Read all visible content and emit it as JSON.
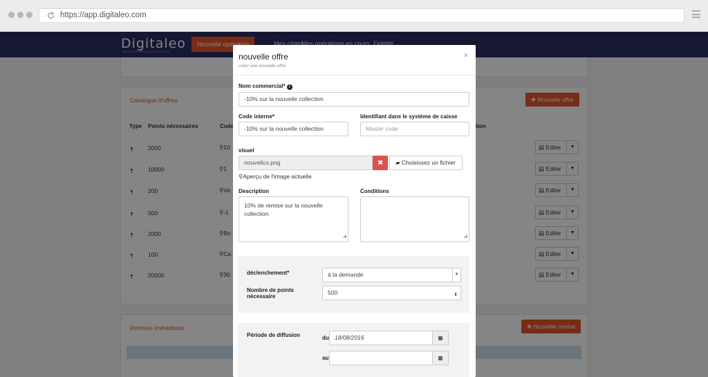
{
  "browser": {
    "url": "https://app.digitaleo.com"
  },
  "nav": {
    "logo": "Digitaleo",
    "logo_sub": "RELATIONNEL & MARKETING",
    "primary_button": "Nouvelle opération",
    "links": [
      "Mes cibles",
      "Mes opérations en cours",
      "Fidélité"
    ]
  },
  "catalogue": {
    "title": "Catalogue d'offres",
    "add_button": "Nouvelle offre",
    "columns": {
      "type": "Type",
      "points": "Points nécessaires",
      "code": "Code",
      "tail": "tion"
    },
    "rows": [
      {
        "points": "2000",
        "code": "10"
      },
      {
        "points": "10000",
        "code": "1"
      },
      {
        "points": "200",
        "code": "Ve"
      },
      {
        "points": "500",
        "code": "-1"
      },
      {
        "points": "2000",
        "code": "Bo"
      },
      {
        "points": "100",
        "code": "Ca"
      },
      {
        "points": "20000",
        "code": "30"
      }
    ],
    "edit_label": "Editer"
  },
  "remises": {
    "title": "Remises immédiates",
    "add_button": "Nouvelle remise"
  },
  "modal": {
    "title": "nouvelle offre",
    "subtitle": "créer une nouvelle offre",
    "close": "×",
    "nom_commercial": {
      "label": "Nom commercial*",
      "value": "-10% sur la nouvelle collection"
    },
    "code_interne": {
      "label": "Code interne*",
      "value": "-10% sur la nouvelle collection"
    },
    "identifiant": {
      "label": "Identifiant dans le système de caisse",
      "placeholder": "Master code"
    },
    "visuel": {
      "label": "visuel",
      "filename": "nouvellco.png",
      "choose_button": "Choisissez un fichier",
      "preview_link": "Aperçu de l'image actuelle"
    },
    "description": {
      "label": "Description",
      "value": "10% de remise sur la nouvelle collection"
    },
    "conditions": {
      "label": "Conditions",
      "value": ""
    },
    "declenchement": {
      "label": "déclenchement*",
      "value": "à la demande"
    },
    "points": {
      "label_line1": "Nombre de points",
      "label_line2": "nécessaire",
      "value": "500"
    },
    "periode": {
      "label": "Période de diffusion",
      "du_label": "du",
      "du_value": "18/08/2016",
      "au_label": "au",
      "au_value": ""
    }
  },
  "icons": {
    "info": "info-icon",
    "remove": "remove-icon",
    "folder": "folder-icon",
    "search": "search-icon",
    "calendar": "calendar-icon"
  }
}
